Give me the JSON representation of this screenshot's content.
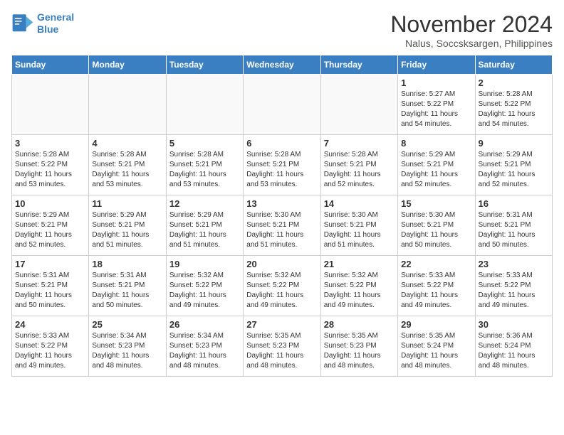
{
  "logo": {
    "line1": "General",
    "line2": "Blue"
  },
  "title": "November 2024",
  "location": "Nalus, Soccsksargen, Philippines",
  "days_of_week": [
    "Sunday",
    "Monday",
    "Tuesday",
    "Wednesday",
    "Thursday",
    "Friday",
    "Saturday"
  ],
  "weeks": [
    [
      {
        "day": "",
        "info": ""
      },
      {
        "day": "",
        "info": ""
      },
      {
        "day": "",
        "info": ""
      },
      {
        "day": "",
        "info": ""
      },
      {
        "day": "",
        "info": ""
      },
      {
        "day": "1",
        "info": "Sunrise: 5:27 AM\nSunset: 5:22 PM\nDaylight: 11 hours\nand 54 minutes."
      },
      {
        "day": "2",
        "info": "Sunrise: 5:28 AM\nSunset: 5:22 PM\nDaylight: 11 hours\nand 54 minutes."
      }
    ],
    [
      {
        "day": "3",
        "info": "Sunrise: 5:28 AM\nSunset: 5:22 PM\nDaylight: 11 hours\nand 53 minutes."
      },
      {
        "day": "4",
        "info": "Sunrise: 5:28 AM\nSunset: 5:21 PM\nDaylight: 11 hours\nand 53 minutes."
      },
      {
        "day": "5",
        "info": "Sunrise: 5:28 AM\nSunset: 5:21 PM\nDaylight: 11 hours\nand 53 minutes."
      },
      {
        "day": "6",
        "info": "Sunrise: 5:28 AM\nSunset: 5:21 PM\nDaylight: 11 hours\nand 53 minutes."
      },
      {
        "day": "7",
        "info": "Sunrise: 5:28 AM\nSunset: 5:21 PM\nDaylight: 11 hours\nand 52 minutes."
      },
      {
        "day": "8",
        "info": "Sunrise: 5:29 AM\nSunset: 5:21 PM\nDaylight: 11 hours\nand 52 minutes."
      },
      {
        "day": "9",
        "info": "Sunrise: 5:29 AM\nSunset: 5:21 PM\nDaylight: 11 hours\nand 52 minutes."
      }
    ],
    [
      {
        "day": "10",
        "info": "Sunrise: 5:29 AM\nSunset: 5:21 PM\nDaylight: 11 hours\nand 52 minutes."
      },
      {
        "day": "11",
        "info": "Sunrise: 5:29 AM\nSunset: 5:21 PM\nDaylight: 11 hours\nand 51 minutes."
      },
      {
        "day": "12",
        "info": "Sunrise: 5:29 AM\nSunset: 5:21 PM\nDaylight: 11 hours\nand 51 minutes."
      },
      {
        "day": "13",
        "info": "Sunrise: 5:30 AM\nSunset: 5:21 PM\nDaylight: 11 hours\nand 51 minutes."
      },
      {
        "day": "14",
        "info": "Sunrise: 5:30 AM\nSunset: 5:21 PM\nDaylight: 11 hours\nand 51 minutes."
      },
      {
        "day": "15",
        "info": "Sunrise: 5:30 AM\nSunset: 5:21 PM\nDaylight: 11 hours\nand 50 minutes."
      },
      {
        "day": "16",
        "info": "Sunrise: 5:31 AM\nSunset: 5:21 PM\nDaylight: 11 hours\nand 50 minutes."
      }
    ],
    [
      {
        "day": "17",
        "info": "Sunrise: 5:31 AM\nSunset: 5:21 PM\nDaylight: 11 hours\nand 50 minutes."
      },
      {
        "day": "18",
        "info": "Sunrise: 5:31 AM\nSunset: 5:21 PM\nDaylight: 11 hours\nand 50 minutes."
      },
      {
        "day": "19",
        "info": "Sunrise: 5:32 AM\nSunset: 5:22 PM\nDaylight: 11 hours\nand 49 minutes."
      },
      {
        "day": "20",
        "info": "Sunrise: 5:32 AM\nSunset: 5:22 PM\nDaylight: 11 hours\nand 49 minutes."
      },
      {
        "day": "21",
        "info": "Sunrise: 5:32 AM\nSunset: 5:22 PM\nDaylight: 11 hours\nand 49 minutes."
      },
      {
        "day": "22",
        "info": "Sunrise: 5:33 AM\nSunset: 5:22 PM\nDaylight: 11 hours\nand 49 minutes."
      },
      {
        "day": "23",
        "info": "Sunrise: 5:33 AM\nSunset: 5:22 PM\nDaylight: 11 hours\nand 49 minutes."
      }
    ],
    [
      {
        "day": "24",
        "info": "Sunrise: 5:33 AM\nSunset: 5:22 PM\nDaylight: 11 hours\nand 49 minutes."
      },
      {
        "day": "25",
        "info": "Sunrise: 5:34 AM\nSunset: 5:23 PM\nDaylight: 11 hours\nand 48 minutes."
      },
      {
        "day": "26",
        "info": "Sunrise: 5:34 AM\nSunset: 5:23 PM\nDaylight: 11 hours\nand 48 minutes."
      },
      {
        "day": "27",
        "info": "Sunrise: 5:35 AM\nSunset: 5:23 PM\nDaylight: 11 hours\nand 48 minutes."
      },
      {
        "day": "28",
        "info": "Sunrise: 5:35 AM\nSunset: 5:23 PM\nDaylight: 11 hours\nand 48 minutes."
      },
      {
        "day": "29",
        "info": "Sunrise: 5:35 AM\nSunset: 5:24 PM\nDaylight: 11 hours\nand 48 minutes."
      },
      {
        "day": "30",
        "info": "Sunrise: 5:36 AM\nSunset: 5:24 PM\nDaylight: 11 hours\nand 48 minutes."
      }
    ]
  ]
}
